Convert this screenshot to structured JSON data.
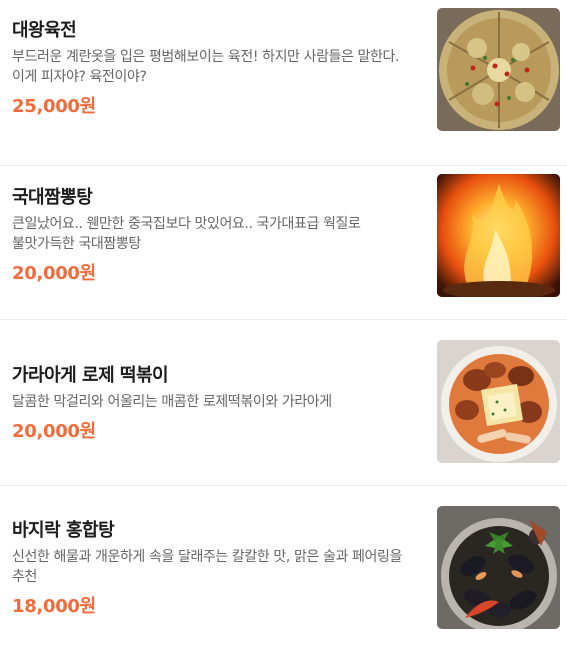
{
  "menu": {
    "items": [
      {
        "name": "대왕육전",
        "description": "부드러운 계란옷을 입은 평범해보이는 육전! 하지만 사람들은 말한다. 이게 피자야? 육전이야?",
        "price": "25,000원",
        "photo": "food-photo-yukjeon"
      },
      {
        "name": "국대짬뽕탕",
        "description": "큰일났어요.. 웬만한 중국집보다 맛있어요.. 국가대표급 웍질로 불맛가득한 국대짬뽕탕",
        "price": "20,000원",
        "photo": "food-photo-jjamppong"
      },
      {
        "name": "가라아게 로제 떡볶이",
        "description": "달콤한 막걸리와 어울리는 매콤한 로제떡볶이와 가라아게",
        "price": "20,000원",
        "photo": "food-photo-rose-tteokbokki"
      },
      {
        "name": "바지락 홍합탕",
        "description": "신선한 해물과 개운하게 속을 달래주는 칼칼한 맛, 맑은 술과 페어링을 추천",
        "price": "18,000원",
        "photo": "food-photo-mussel-soup"
      }
    ]
  }
}
